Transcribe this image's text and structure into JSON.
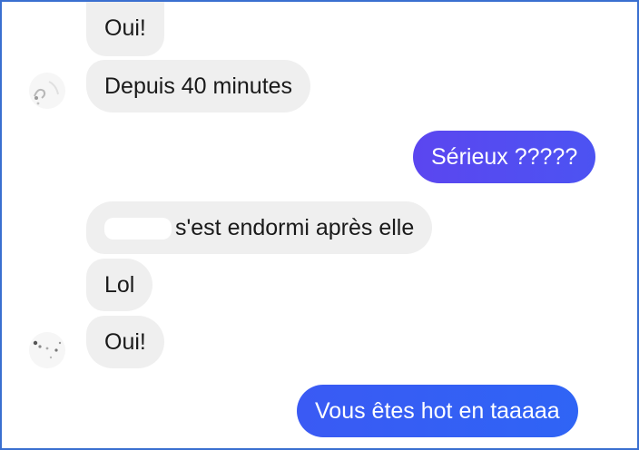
{
  "colors": {
    "incoming_bubble": "#efefef",
    "outgoing_gradient_start": "#5b46f0",
    "outgoing_gradient_end": "#2f64f5",
    "frame_border": "#3a6fd0"
  },
  "messages": [
    {
      "direction": "incoming",
      "text": "Oui!"
    },
    {
      "direction": "incoming",
      "text": "Depuis 40 minutes"
    },
    {
      "direction": "outgoing",
      "text": "Sérieux ?????"
    },
    {
      "direction": "incoming",
      "text": "s'est endormi après elle",
      "redacted_prefix": true
    },
    {
      "direction": "incoming",
      "text": "Lol"
    },
    {
      "direction": "incoming",
      "text": "Oui!"
    },
    {
      "direction": "outgoing",
      "text": "Vous êtes hot en taaaaa"
    }
  ]
}
